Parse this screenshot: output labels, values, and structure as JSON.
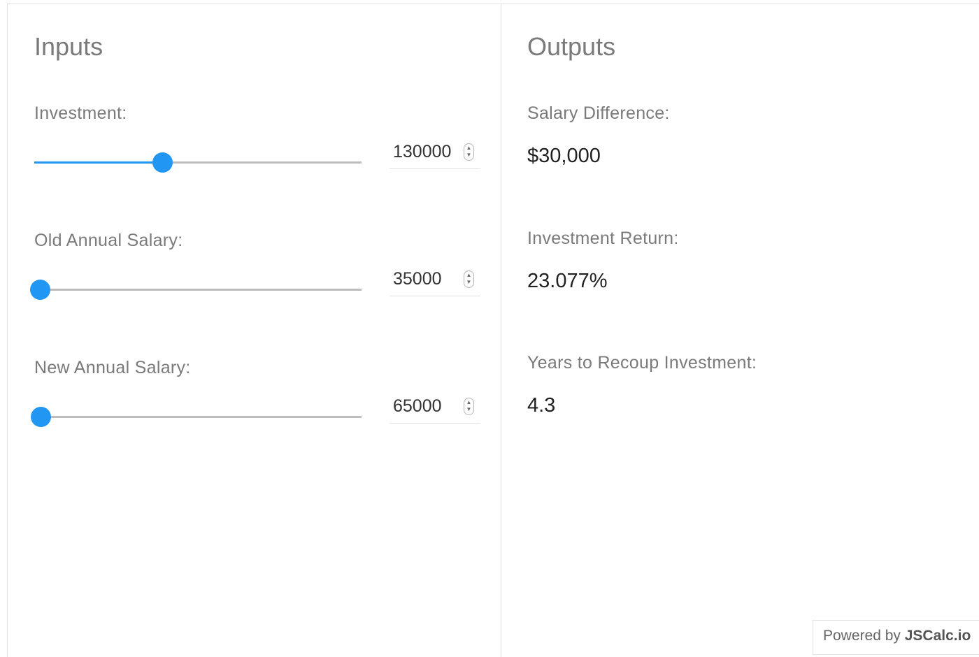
{
  "inputs": {
    "title": "Inputs",
    "fields": [
      {
        "label": "Investment:",
        "value": "130000",
        "slider_fraction": 0.39
      },
      {
        "label": "Old Annual Salary:",
        "value": "35000",
        "slider_fraction": 0.0
      },
      {
        "label": "New Annual Salary:",
        "value": "65000",
        "slider_fraction": 0.02
      }
    ]
  },
  "outputs": {
    "title": "Outputs",
    "results": [
      {
        "label": "Salary Difference:",
        "value": "$30,000"
      },
      {
        "label": "Investment Return:",
        "value": "23.077%"
      },
      {
        "label": "Years to Recoup Investment:",
        "value": "4.3"
      }
    ]
  },
  "footer": {
    "powered_prefix": "Powered by ",
    "powered_brand": "JSCalc.io"
  },
  "colors": {
    "accent": "#2196f3",
    "track": "#bdbdbd",
    "label": "#7a7a7a"
  },
  "icons": {
    "spinner": "number-spinner-icon"
  }
}
